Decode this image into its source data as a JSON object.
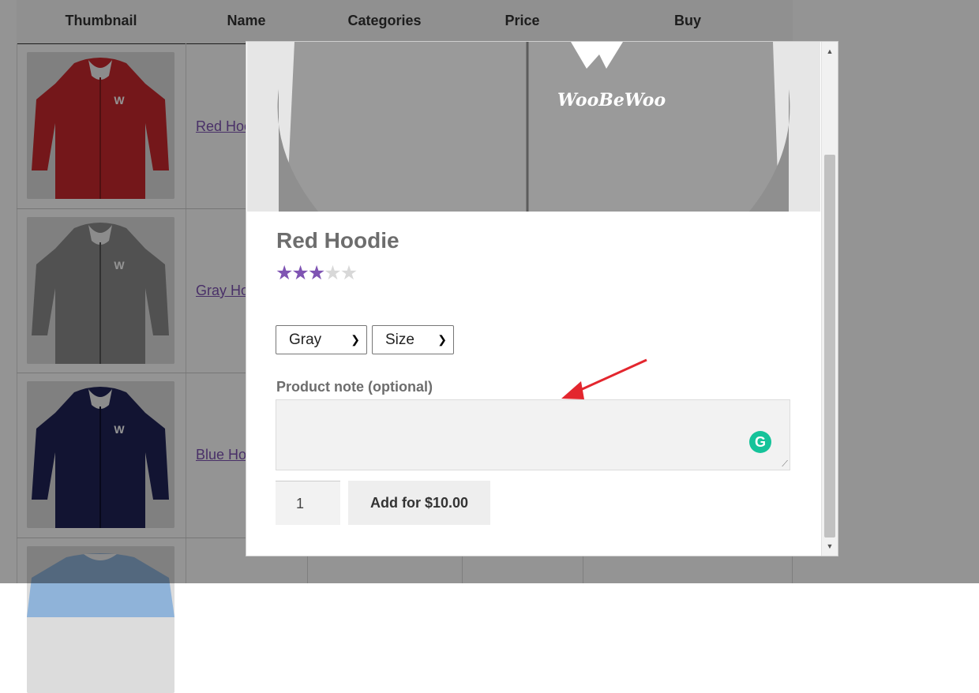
{
  "table": {
    "headers": [
      "Thumbnail",
      "Name",
      "Categories",
      "Price",
      "Buy"
    ],
    "rows": [
      {
        "name": "Red Hoodie",
        "color": "#c9282d"
      },
      {
        "name": "Gray Hoodie",
        "color": "#8c8c8c"
      },
      {
        "name": "Blue Hoodie",
        "color": "#1f2357"
      },
      {
        "name": "",
        "color": "#8fb3d9"
      }
    ]
  },
  "modal": {
    "brand": "WooBeWoo",
    "title": "Red Hoodie",
    "rating": 3,
    "rating_max": 5,
    "color_select": "Gray",
    "size_select": "Size",
    "note_label": "Product note (optional)",
    "quantity": "1",
    "add_button": "Add for $10.00"
  },
  "colors": {
    "accent": "#7f54b3",
    "grammarly": "#15c39a",
    "arrow": "#e3262e"
  }
}
